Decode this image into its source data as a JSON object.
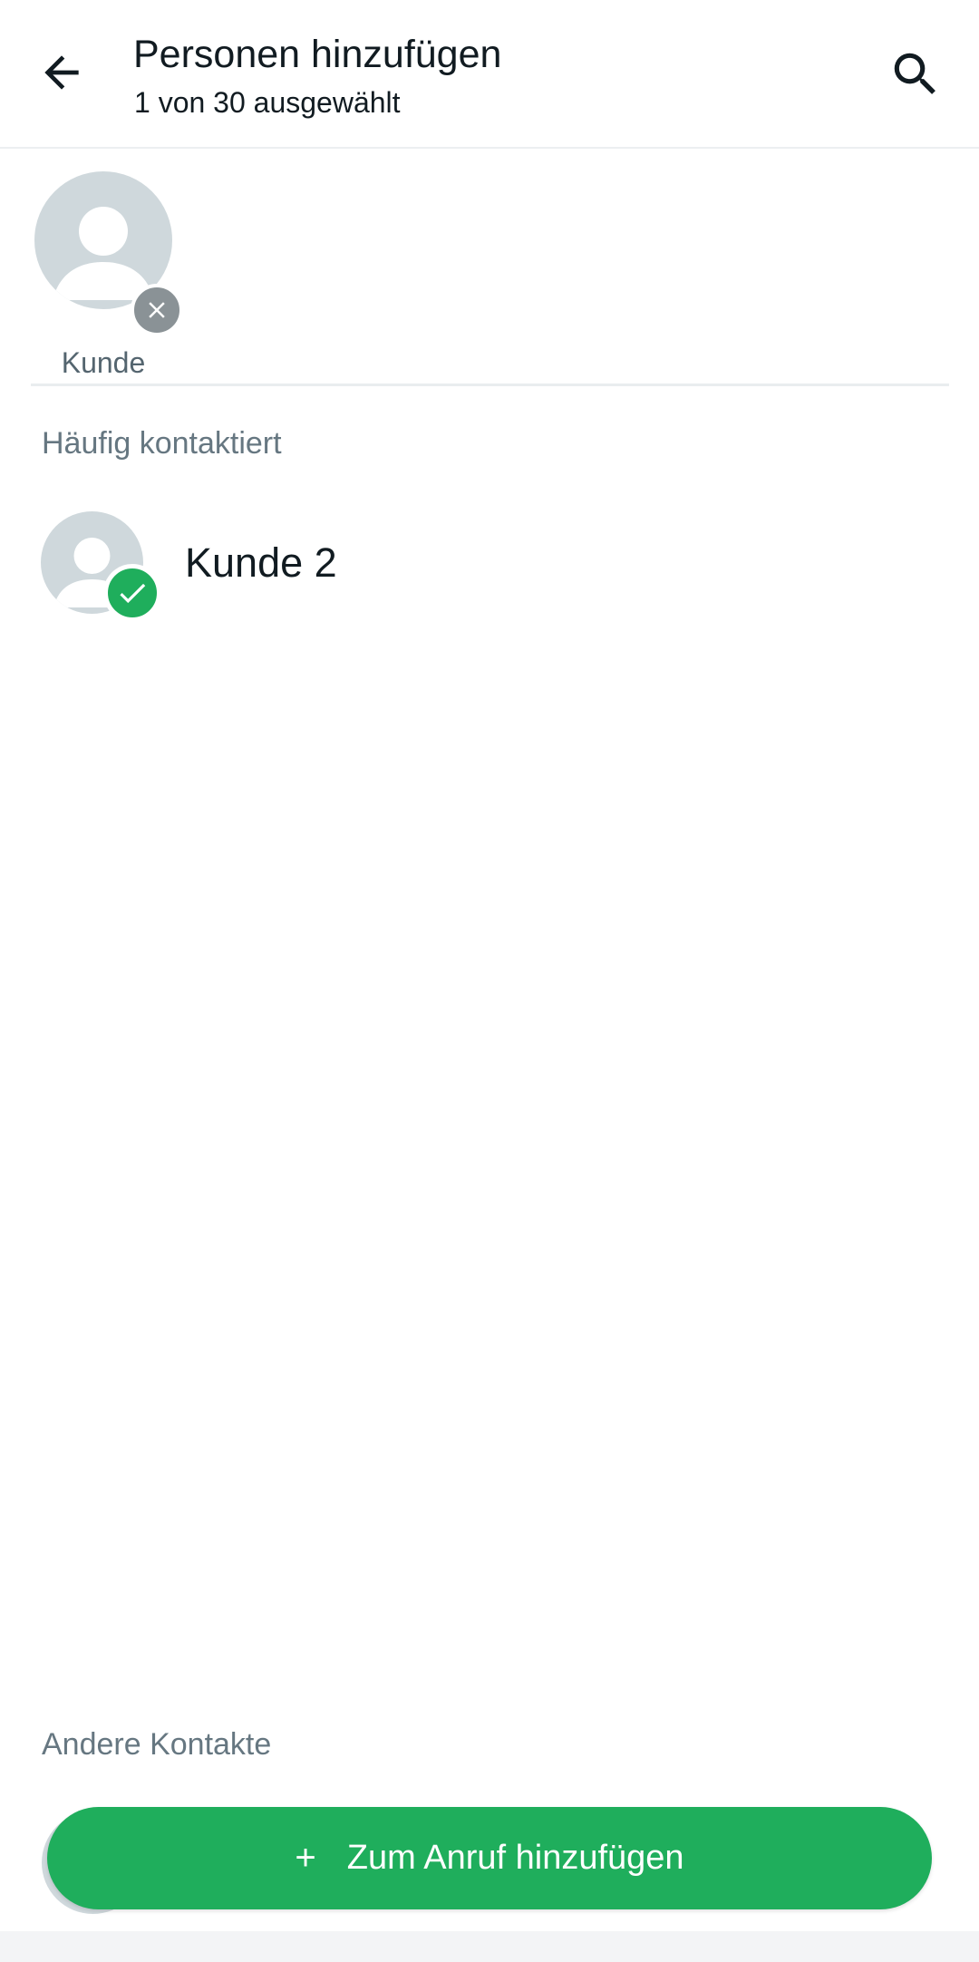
{
  "header": {
    "title": "Personen hinzufügen",
    "subtitle": "1 von 30 ausgewählt",
    "back_icon": "arrow-left-icon",
    "search_icon": "search-icon"
  },
  "selected": [
    {
      "label": "Kunde"
    }
  ],
  "sections": {
    "frequent": "Häufig kontaktiert",
    "other": "Andere Kontakte"
  },
  "contacts": [
    {
      "name": "Kunde 2",
      "checked": true
    }
  ],
  "action": {
    "plus": "+",
    "label": "Zum Anruf hinzufügen"
  },
  "colors": {
    "accent": "#1fae5c",
    "avatar_bg": "#cfd8dc",
    "remove_bg": "#8a9296"
  }
}
